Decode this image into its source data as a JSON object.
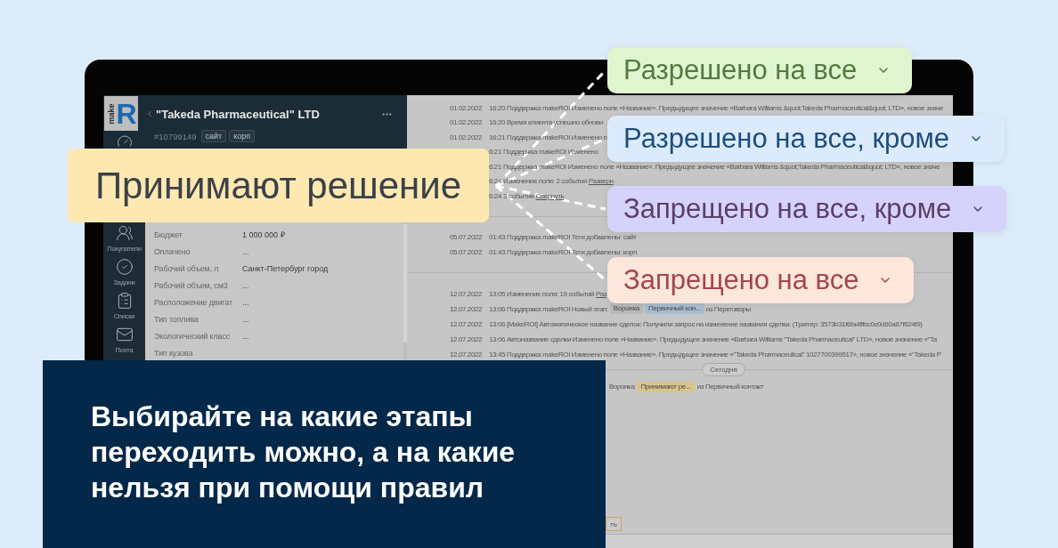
{
  "screen": {
    "sidebar": {
      "logo": {
        "word": "make",
        "letter": "R"
      },
      "items": [
        {
          "label": "Покупатели"
        },
        {
          "label": "Задачи"
        },
        {
          "label": "Списки"
        },
        {
          "label": "Почта"
        }
      ]
    },
    "card": {
      "title": "\"Takeda Pharmaceutical\" LTD",
      "number": "#10799149",
      "tags": [
        "сайт",
        "корп"
      ],
      "fields": [
        {
          "label": "Бюджет",
          "value": "1 000 000 ₽"
        },
        {
          "label": "Оплачено",
          "value": "..."
        },
        {
          "label": "Рабочий объем, л",
          "value": "Санкт-Петербург город"
        },
        {
          "label": "Рабочий объем, см3",
          "value": "..."
        },
        {
          "label": "Расположение двигат",
          "value": "..."
        },
        {
          "label": "Тип топлива",
          "value": "..."
        },
        {
          "label": "Экологический класс",
          "value": "..."
        },
        {
          "label": "Тип кузова"
        }
      ]
    },
    "log": {
      "groups": [
        {
          "entries": [
            {
              "date": "01.02.2022",
              "time": "16:20",
              "parts": [
                {
                  "kind": "text",
                  "text": "Поддержка makeROI Изменено поле «Название». Предыдущее значение «Barbara Williams &quot;Takeda Pharmaceutical&quot; LTD», новое значе"
                }
              ]
            },
            {
              "date": "01.02.2022",
              "time": "16:20",
              "parts": [
                {
                  "kind": "text",
                  "text": "Время клиента успешно обнови"
                }
              ]
            },
            {
              "date": "01.02.2022",
              "time": "16:21",
              "parts": [
                {
                  "kind": "text",
                  "text": "Поддержка makeROI Изменено п"
                }
              ]
            },
            {
              "time": "6:21",
              "parts": [
                {
                  "kind": "text",
                  "text": "Поддержка makeROI Изменено"
                }
              ]
            },
            {
              "time": "6:21",
              "parts": [
                {
                  "kind": "text",
                  "text": "Поддержка makeROI Изменено поле «Название». Предыдущее значение «Barbara Williams &quot;Takeda Pharmaceutical&quot; LTD», новое значе"
                }
              ]
            },
            {
              "time": "6:24",
              "parts": [
                {
                  "kind": "text",
                  "text": "Изменение поля: 2 события"
                },
                {
                  "kind": "link",
                  "text": "Разверн"
                }
              ]
            },
            {
              "time": "6:24",
              "parts": [
                {
                  "kind": "text",
                  "text": "3 события"
                },
                {
                  "kind": "link",
                  "text": "Свернуть"
                }
              ]
            }
          ]
        },
        {
          "entries": [
            {
              "date": "05.07.2022",
              "time": "01:43",
              "parts": [
                {
                  "kind": "text",
                  "text": "Поддержка makeROI Теги добавлены: сайт"
                }
              ]
            },
            {
              "date": "05.07.2022",
              "time": "01:43",
              "parts": [
                {
                  "kind": "text",
                  "text": "Поддержка makeROI Теги добавлены: корп"
                }
              ]
            }
          ]
        },
        {
          "entries": [
            {
              "date": "12.07.2022",
              "time": "13:05",
              "parts": [
                {
                  "kind": "text",
                  "text": "Изменение поля: 19 событий"
                },
                {
                  "kind": "link",
                  "text": "Раз"
                }
              ]
            },
            {
              "date": "12.07.2022",
              "time": "13:06",
              "parts": [
                {
                  "kind": "text",
                  "text": "Поддержка makeROI Новый этап:"
                },
                {
                  "kind": "chip",
                  "text": "Воронка",
                  "color": "#b9b9b9"
                },
                {
                  "kind": "chip",
                  "text": "Первичный кон...",
                  "color": "#a9bdd1"
                },
                {
                  "kind": "text",
                  "text": "из Переговоры"
                }
              ]
            },
            {
              "date": "12.07.2022",
              "time": "13:06",
              "parts": [
                {
                  "kind": "text",
                  "text": "[MakeROI] Автоматическое название сделок: Получили запрос на изменение названия сделки. (Триггер: 3573b31f6fa4fffcc0c0d60a87f624f9)"
                }
              ]
            },
            {
              "date": "12.07.2022",
              "time": "13:06",
              "parts": [
                {
                  "kind": "text",
                  "text": "Автоназвание сделки Изменено поле «Название». Предыдущее значение «Barbara Williams \"Takeda Pharmaceutical\" LTD», новое значение «\"Ta"
                }
              ]
            },
            {
              "date": "12.07.2022",
              "time": "13:45",
              "parts": [
                {
                  "kind": "text",
                  "text": "Поддержка makeROI Изменено поле «Название». Предыдущее значение «\"Takeda Pharmaceutical\" 1027700399517», новое значение «\"Takeda P"
                }
              ]
            }
          ]
        }
      ],
      "today": {
        "label": "Сегодня",
        "entries": [
          {
            "parts": [
              {
                "kind": "text",
                "text": "Воронка"
              },
              {
                "kind": "chip",
                "text": "Принимают ре...",
                "color": "#d9c48c"
              },
              {
                "kind": "text",
                "text": "из Первичный контакт"
              }
            ]
          }
        ],
        "button": "ть"
      }
    }
  },
  "stage_label": "Принимают решение",
  "rules": [
    {
      "label": "Разрешено на все",
      "color": "#dff5cf",
      "kind": "allow",
      "except": false
    },
    {
      "label": "Разрешено на все, кроме",
      "color": "#dcebfc",
      "kind": "allow",
      "except": true
    },
    {
      "label": "Запрещено на все, кроме",
      "color": "#d5d3fb",
      "kind": "deny",
      "except": true
    },
    {
      "label": "Запрещено на все",
      "color": "#fde6dc",
      "kind": "deny",
      "except": false
    }
  ],
  "caption": "Выбирайте на какие этапы переходить можно, а на какие нельзя при помощи правил"
}
